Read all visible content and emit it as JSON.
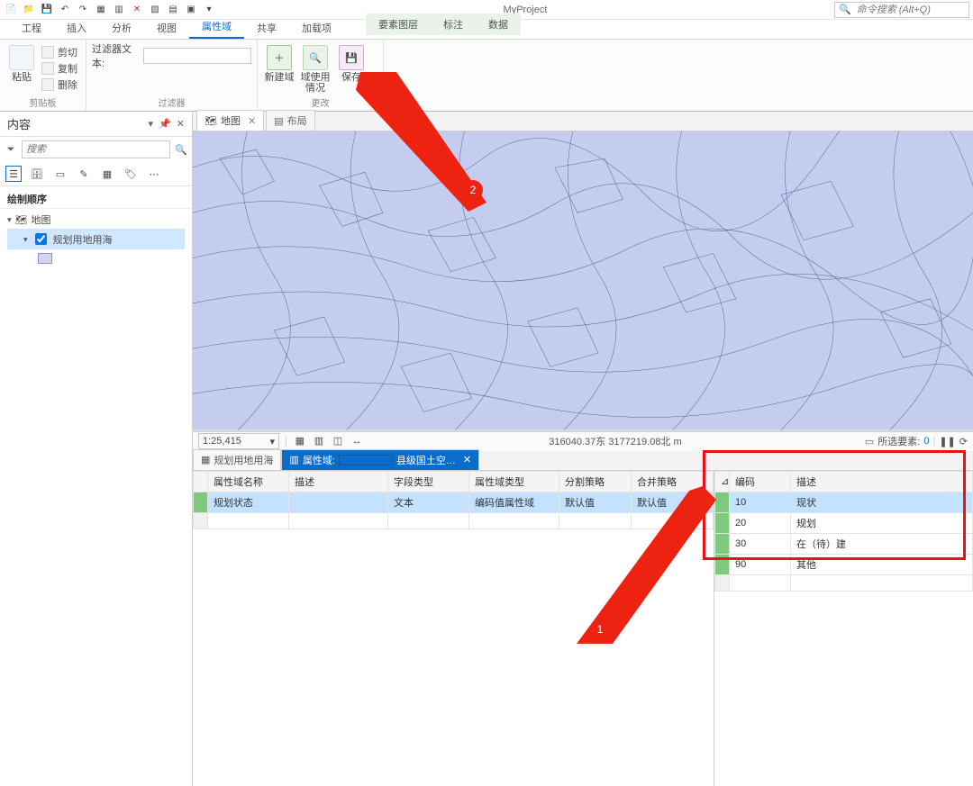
{
  "title": "MyProject",
  "command_search_placeholder": "命令搜索 (Alt+Q)",
  "ribbon_tabs": [
    "工程",
    "插入",
    "分析",
    "视图",
    "属性域",
    "共享",
    "加载项"
  ],
  "ribbon_ctx_tabs": [
    "要素图层",
    "标注",
    "数据"
  ],
  "ribbon_active_tab": "属性域",
  "ribbon": {
    "clipboard": {
      "paste": "粘贴",
      "cut": "剪切",
      "copy": "复制",
      "delete": "删除",
      "title": "剪贴板"
    },
    "filter_label": "过滤器文本:",
    "filter_group_title": "过滤器",
    "changes": {
      "new_domain": "新建域",
      "domain_usage": "域使用情况",
      "save": "保存",
      "title": "更改"
    }
  },
  "contents": {
    "pane_title": "内容",
    "search_placeholder": "搜索",
    "section_title": "绘制顺序",
    "map_node": "地图",
    "layer_node": "规划用地用海"
  },
  "view_tabs": {
    "map": "地图",
    "layout": "布局"
  },
  "statusbar": {
    "scale": "1:25,415",
    "coords": "316040.37东 3177219.08北 m",
    "selected_label": "所选要素:",
    "selected_count": "0"
  },
  "bottom_tabs": {
    "attrib_table": "规划用地用海",
    "domain_tab_prefix": "属性域:",
    "domain_tab_suffix": "县级国土空…"
  },
  "domain_table": {
    "headers": [
      "属性域名称",
      "描述",
      "字段类型",
      "属性域类型",
      "分割策略",
      "合并策略"
    ],
    "row": {
      "name": "规划状态",
      "desc": "",
      "field_type": "文本",
      "domain_type": "编码值属性域",
      "split": "默认值",
      "merge": "默认值"
    }
  },
  "code_table": {
    "headers": [
      "编码",
      "描述"
    ],
    "rows": [
      {
        "code": "10",
        "desc": "现状"
      },
      {
        "code": "20",
        "desc": "规划"
      },
      {
        "code": "30",
        "desc": "在（待）建"
      },
      {
        "code": "90",
        "desc": "其他"
      }
    ]
  },
  "callouts": {
    "c1": "1",
    "c2": "2"
  }
}
